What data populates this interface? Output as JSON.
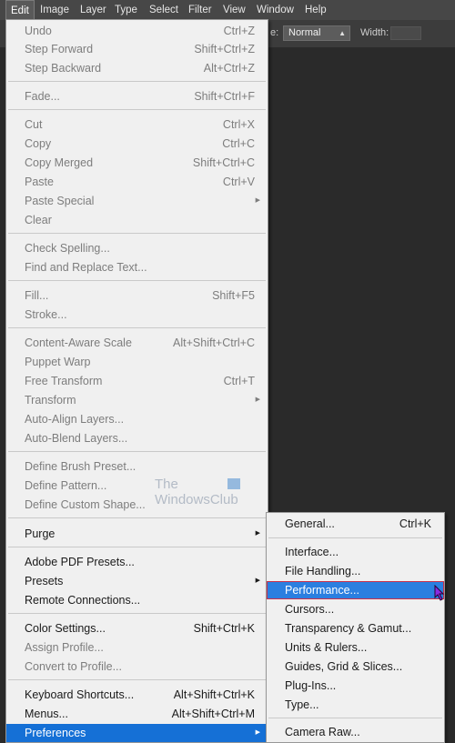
{
  "menubar": {
    "items": [
      {
        "label": "Edit",
        "active": true
      },
      {
        "label": "Image"
      },
      {
        "label": "Type"
      },
      {
        "label": "Layer"
      },
      {
        "label": "Select"
      },
      {
        "label": "Filter"
      },
      {
        "label": "View"
      },
      {
        "label": "Window"
      },
      {
        "label": "Help"
      }
    ]
  },
  "optionsbar": {
    "mode_label_fragment": "e:",
    "mode_value": "Normal",
    "width_label": "Width:"
  },
  "edit_menu": {
    "items": [
      {
        "label": "Undo",
        "shortcut": "Ctrl+Z",
        "disabled": true
      },
      {
        "label": "Step Forward",
        "shortcut": "Shift+Ctrl+Z",
        "disabled": true
      },
      {
        "label": "Step Backward",
        "shortcut": "Alt+Ctrl+Z",
        "disabled": true
      },
      {
        "label": "Fade...",
        "shortcut": "Shift+Ctrl+F",
        "disabled": true
      },
      {
        "label": "Cut",
        "shortcut": "Ctrl+X",
        "disabled": true
      },
      {
        "label": "Copy",
        "shortcut": "Ctrl+C",
        "disabled": true
      },
      {
        "label": "Copy Merged",
        "shortcut": "Shift+Ctrl+C",
        "disabled": true
      },
      {
        "label": "Paste",
        "shortcut": "Ctrl+V",
        "disabled": true
      },
      {
        "label": "Paste Special",
        "shortcut": "",
        "disabled": true,
        "submenu": true
      },
      {
        "label": "Clear",
        "shortcut": "",
        "disabled": true
      },
      {
        "label": "Check Spelling...",
        "shortcut": "",
        "disabled": true
      },
      {
        "label": "Find and Replace Text...",
        "shortcut": "",
        "disabled": true
      },
      {
        "label": "Fill...",
        "shortcut": "Shift+F5",
        "disabled": true
      },
      {
        "label": "Stroke...",
        "shortcut": "",
        "disabled": true
      },
      {
        "label": "Content-Aware Scale",
        "shortcut": "Alt+Shift+Ctrl+C",
        "disabled": true
      },
      {
        "label": "Puppet Warp",
        "shortcut": "",
        "disabled": true
      },
      {
        "label": "Free Transform",
        "shortcut": "Ctrl+T",
        "disabled": true
      },
      {
        "label": "Transform",
        "shortcut": "",
        "disabled": true,
        "submenu": true
      },
      {
        "label": "Auto-Align Layers...",
        "shortcut": "",
        "disabled": true
      },
      {
        "label": "Auto-Blend Layers...",
        "shortcut": "",
        "disabled": true
      },
      {
        "label": "Define Brush Preset...",
        "shortcut": "",
        "disabled": true
      },
      {
        "label": "Define Pattern...",
        "shortcut": "",
        "disabled": true
      },
      {
        "label": "Define Custom Shape...",
        "shortcut": "",
        "disabled": true
      },
      {
        "label": "Purge",
        "shortcut": "",
        "disabled": false,
        "submenu": true
      },
      {
        "label": "Adobe PDF Presets...",
        "shortcut": "",
        "disabled": false
      },
      {
        "label": "Presets",
        "shortcut": "",
        "disabled": false,
        "submenu": true
      },
      {
        "label": "Remote Connections...",
        "shortcut": "",
        "disabled": false
      },
      {
        "label": "Color Settings...",
        "shortcut": "Shift+Ctrl+K",
        "disabled": false
      },
      {
        "label": "Assign Profile...",
        "shortcut": "",
        "disabled": true
      },
      {
        "label": "Convert to Profile...",
        "shortcut": "",
        "disabled": true
      },
      {
        "label": "Keyboard Shortcuts...",
        "shortcut": "Alt+Shift+Ctrl+K",
        "disabled": false
      },
      {
        "label": "Menus...",
        "shortcut": "Alt+Shift+Ctrl+M",
        "disabled": false
      },
      {
        "label": "Preferences",
        "shortcut": "",
        "disabled": false,
        "submenu": true,
        "highlighted": true
      }
    ]
  },
  "preferences_menu": {
    "items": [
      {
        "label": "General...",
        "shortcut": "Ctrl+K"
      },
      {
        "label": "Interface..."
      },
      {
        "label": "File Handling..."
      },
      {
        "label": "Performance...",
        "hovered": true
      },
      {
        "label": "Cursors..."
      },
      {
        "label": "Transparency & Gamut..."
      },
      {
        "label": "Units & Rulers..."
      },
      {
        "label": "Guides, Grid & Slices..."
      },
      {
        "label": "Plug-Ins..."
      },
      {
        "label": "Type..."
      },
      {
        "label": "Camera Raw..."
      }
    ]
  },
  "watermark": {
    "line1": "The",
    "line2": "WindowsClub"
  },
  "colors": {
    "menu_bg": "#f0f0f0",
    "highlight": "#1570d6",
    "disabled_text": "#7d7d7d",
    "app_bg": "#323232"
  }
}
